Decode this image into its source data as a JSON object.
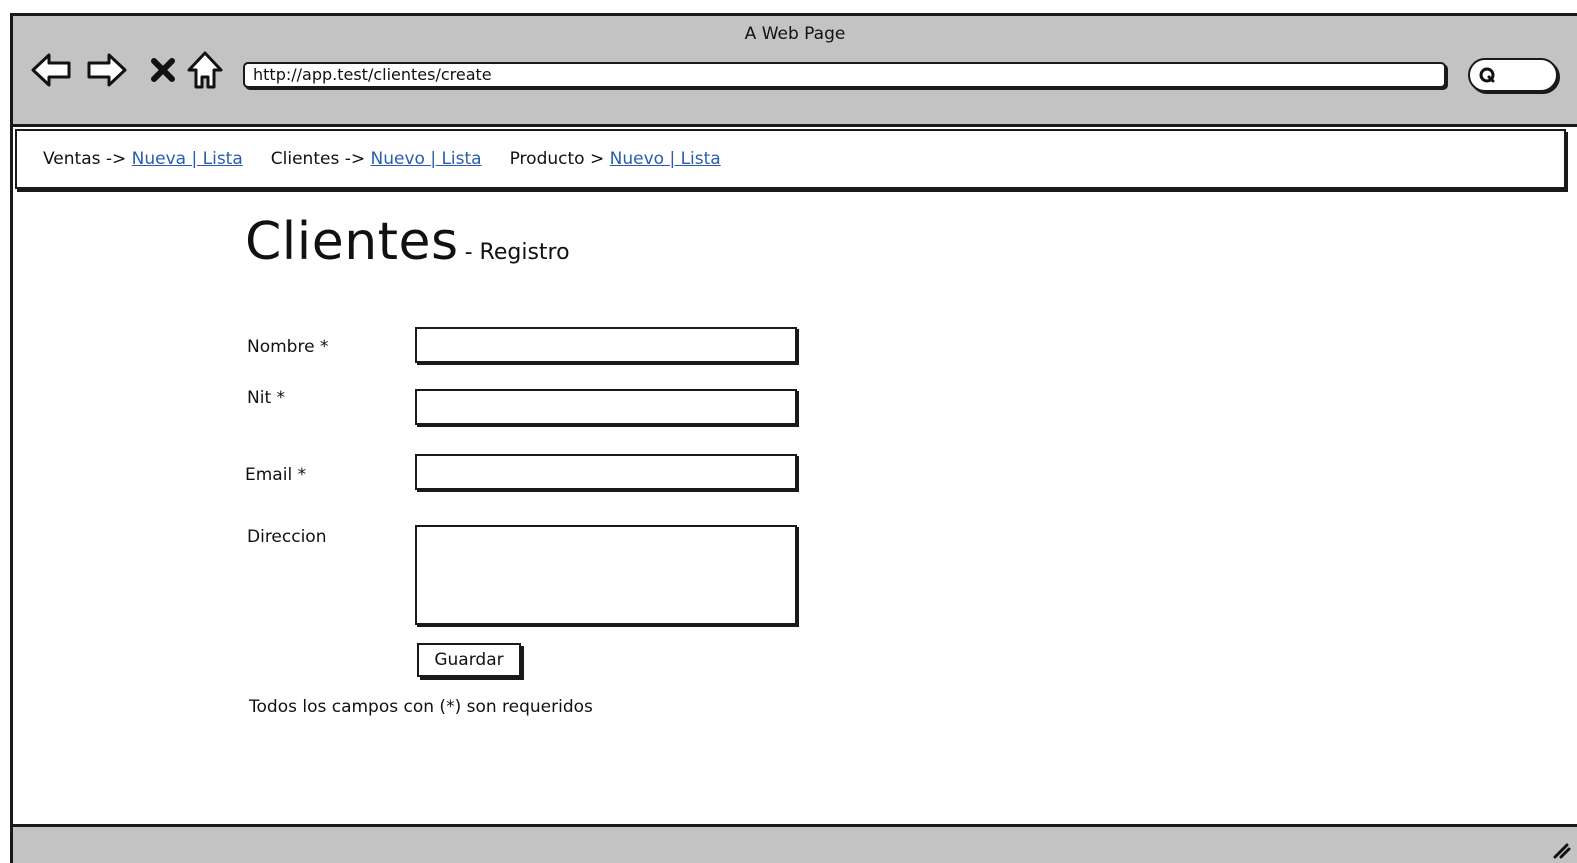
{
  "window": {
    "title": "A Web Page"
  },
  "browser": {
    "url": "http://app.test/clientes/create",
    "icons": [
      "back-arrow-icon",
      "forward-arrow-icon",
      "stop-x-icon",
      "home-icon",
      "search-icon"
    ]
  },
  "menu": {
    "groups": [
      {
        "label": "Ventas ->",
        "links": "Nueva | Lista"
      },
      {
        "label": "Clientes ->",
        "links": "Nuevo | Lista"
      },
      {
        "label": "Producto >",
        "links": "Nuevo | Lista"
      }
    ]
  },
  "page": {
    "title": "Clientes",
    "subtitle": "- Registro"
  },
  "form": {
    "nombre_label": "Nombre *",
    "nit_label": "Nit *",
    "email_label": "Email *",
    "direccion_label": "Direccion",
    "nombre_value": "",
    "nit_value": "",
    "email_value": "",
    "direccion_value": "",
    "save_label": "Guardar",
    "note": "Todos los campos con (*) son requeridos"
  },
  "colors": {
    "chrome": "#c3c3c3",
    "link": "#2a5db0",
    "border": "#1a1a1a"
  }
}
